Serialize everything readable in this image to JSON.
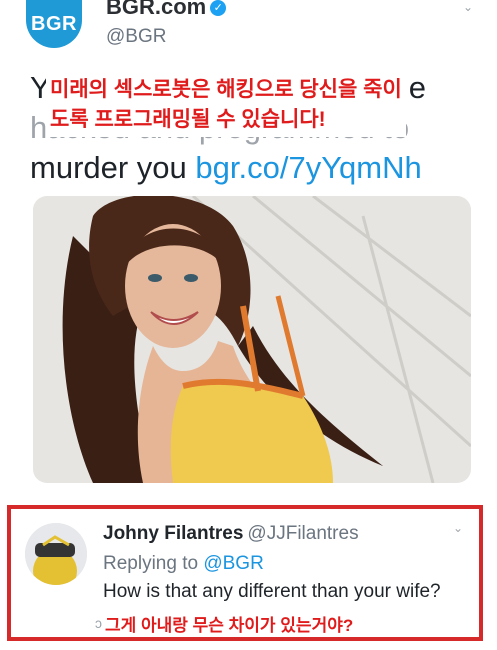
{
  "tweet": {
    "avatar_text": "BGR",
    "name": "BGR.com",
    "handle": "@BGR",
    "text_line1_start": "Y",
    "text_line1_end": "e",
    "text_line2": "hacked and programmed to",
    "text_line3_start": "murder you ",
    "link": "bgr.co/7yYqmNh",
    "overlay_korean": "미래의 섹스로봇은 해킹으로 당신을 죽이도록 프로그래밍될 수 있습니다!"
  },
  "reply": {
    "name": "Johny Filantres",
    "handle": "@JJFilantres",
    "replying_prefix": "Replying to ",
    "replying_handle": "@BGR",
    "text": "How is that any different than your wife?",
    "korean": "그게 아내랑 무슨 차이가 있는거야?"
  },
  "colors": {
    "accent_blue": "#1b95e0",
    "brand_blue": "#1f9ad6",
    "overlay_red": "#e01b1b",
    "box_red": "#d62a2a"
  },
  "icons": [
    "verified-badge-icon",
    "chevron-down-icon"
  ]
}
